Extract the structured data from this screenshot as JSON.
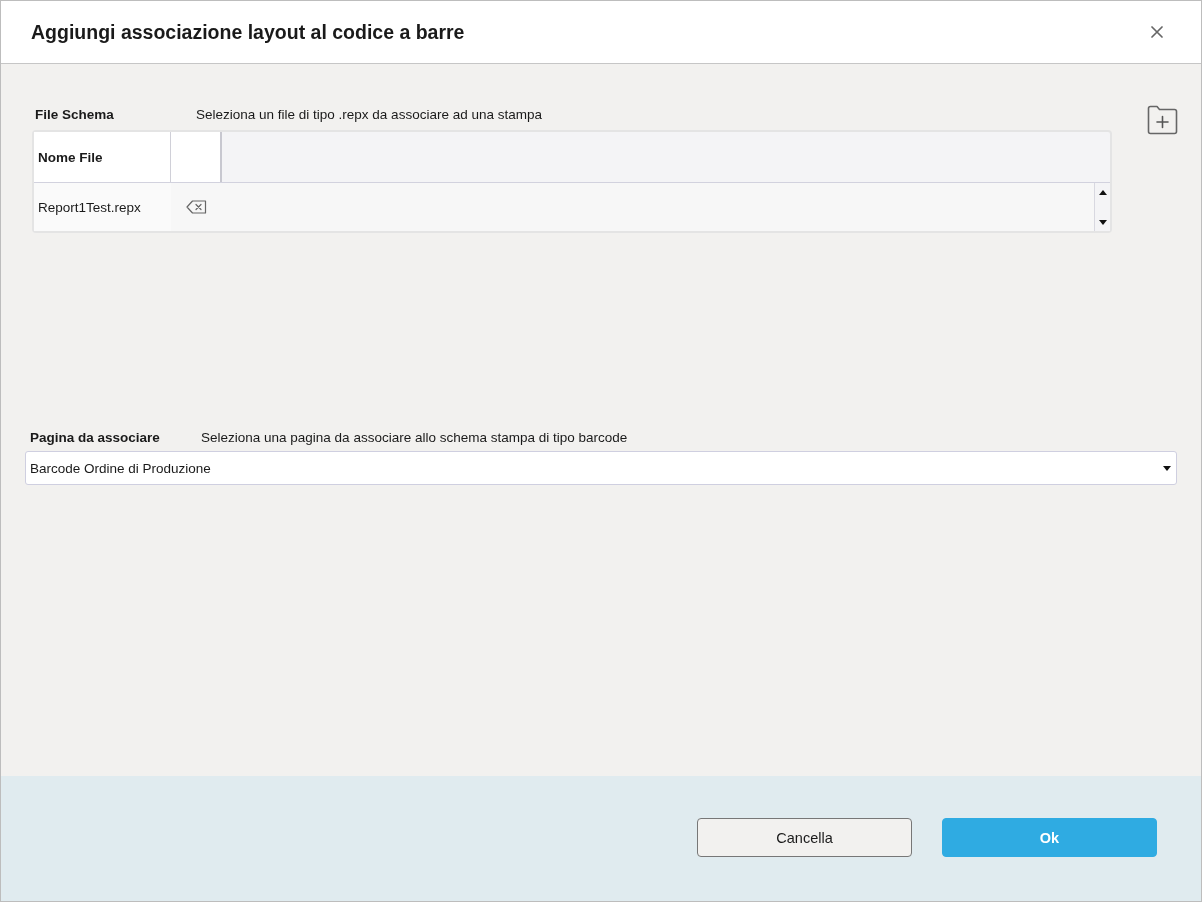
{
  "dialog": {
    "title": "Aggiungi associazione layout al codice a barre"
  },
  "file_schema": {
    "label": "File Schema",
    "hint": "Seleziona un file di tipo .repx da associare ad una stampa",
    "table": {
      "columns": [
        "Nome File"
      ],
      "rows": [
        {
          "cells": [
            "Report1Test.repx"
          ]
        }
      ]
    }
  },
  "page_select": {
    "label": "Pagina da associare",
    "hint": "Seleziona una pagina da associare allo schema stampa di tipo barcode",
    "value": "Barcode Ordine di Produzione"
  },
  "buttons": [
    {
      "label": "Cancella",
      "kind": "secondary"
    },
    {
      "label": "Ok",
      "kind": "primary"
    }
  ]
}
